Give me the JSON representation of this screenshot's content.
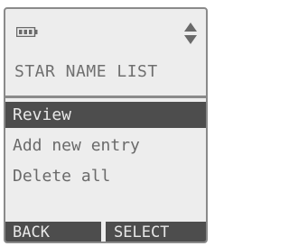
{
  "title": "STAR NAME LIST",
  "menu": {
    "items": [
      {
        "label": "Review",
        "selected": true
      },
      {
        "label": "Add new entry",
        "selected": false
      },
      {
        "label": "Delete all",
        "selected": false
      }
    ]
  },
  "softkeys": {
    "left_label": "BACK",
    "right_label": "SELECT"
  },
  "icons": {
    "battery": "battery-icon",
    "scroll": "up-down-arrows-icon"
  },
  "colors": {
    "screen_background": "#ededed",
    "highlight": "#4d4d4d",
    "text": "#6a6a6a",
    "highlight_text": "#e8e8e8"
  }
}
